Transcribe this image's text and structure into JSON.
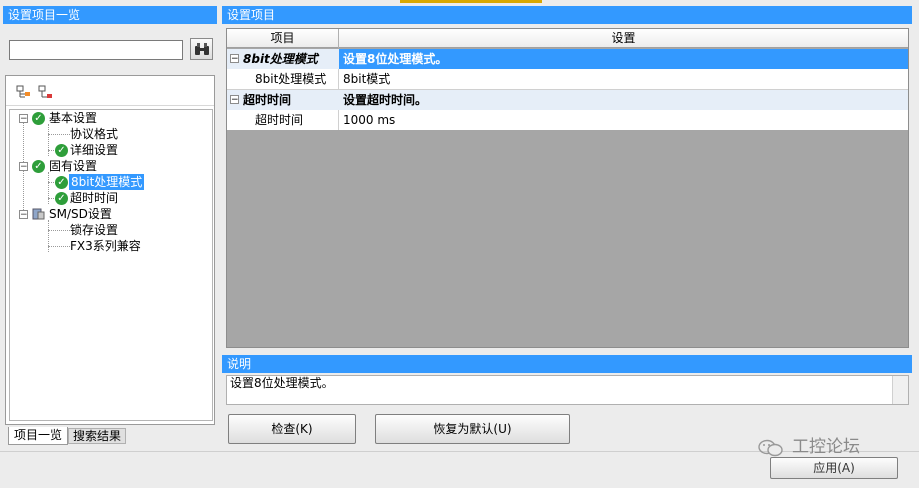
{
  "left_panel": {
    "title": "设置项目一览",
    "search_value": "",
    "tree": [
      {
        "label": "基本设置"
      },
      {
        "label": "协议格式"
      },
      {
        "label": "详细设置"
      },
      {
        "label": "固有设置"
      },
      {
        "label": "8bit处理模式"
      },
      {
        "label": "超时时间"
      },
      {
        "label": "SM/SD设置"
      },
      {
        "label": "锁存设置"
      },
      {
        "label": "FX3系列兼容"
      }
    ],
    "tabs": [
      "项目一览",
      "搜索结果"
    ]
  },
  "right_panel": {
    "title": "设置项目",
    "grid_headers": [
      "项目",
      "设置"
    ],
    "rows": [
      {
        "name": "8bit处理模式",
        "value": "设置8位处理模式。"
      },
      {
        "name": "8bit处理模式",
        "value": "8bit模式"
      },
      {
        "name": "超时时间",
        "value": "设置超时时间。"
      },
      {
        "name": "超时时间",
        "value": "1000 ms"
      }
    ],
    "desc_title": "说明",
    "desc_text": "设置8位处理模式。"
  },
  "buttons": {
    "check": "检查(K)",
    "reset": "恢复为默认(U)",
    "apply": "应用(A)"
  },
  "watermark": "工控论坛",
  "colors": {
    "accent": "#3399ff",
    "check_green": "#2e9e3a",
    "grid_bg": "#a6a6a6"
  }
}
